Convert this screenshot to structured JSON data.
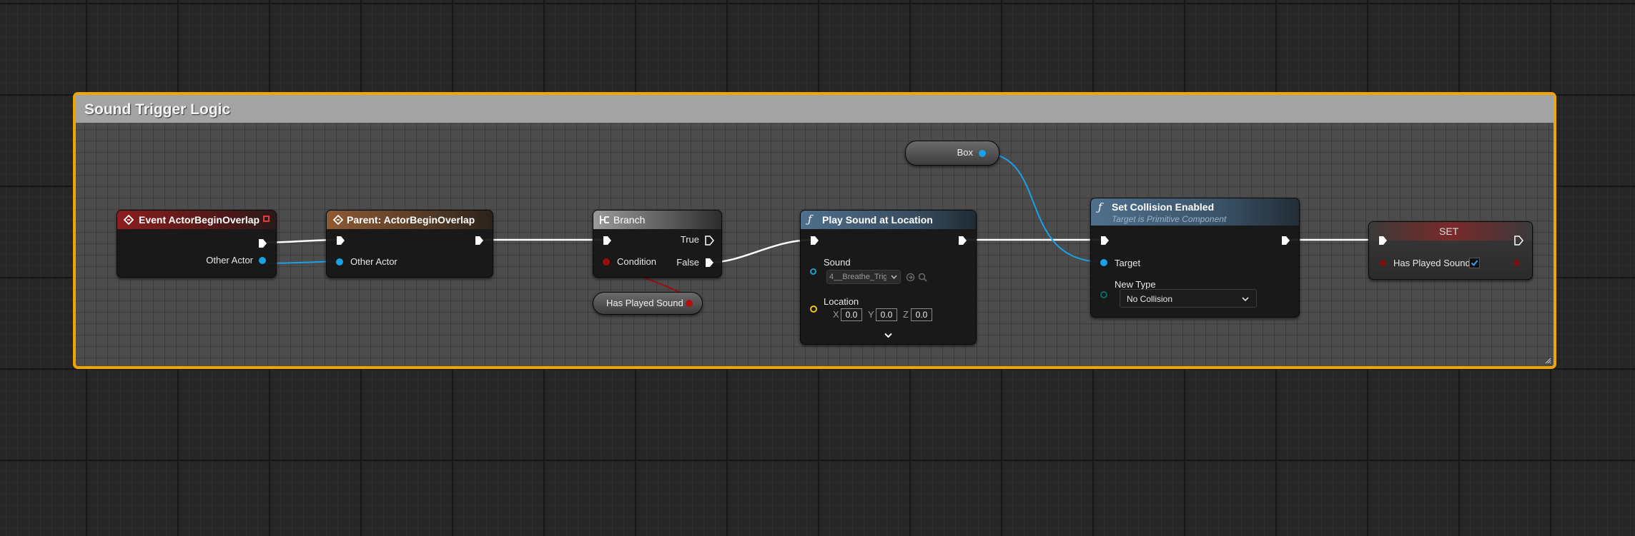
{
  "comment": {
    "title": "Sound Trigger Logic"
  },
  "colors": {
    "exec": "#ffffff",
    "object_pin": "#1aa1e6",
    "bool_pin": "#9d0e0e",
    "vector_pin": "#f0c21a",
    "sound_pin": "#1f9ec6",
    "comment_border": "#f0a400",
    "event_header": "#7c1f1f",
    "parent_header": "#8a5a36",
    "function_header": "#4d6f8e",
    "set_header": "#7a2a2a"
  },
  "nodes": {
    "event": {
      "title": "Event ActorBeginOverlap",
      "icon": "event-diamond-icon",
      "pin_other_actor": "Other Actor"
    },
    "parent": {
      "title": "Parent: ActorBeginOverlap",
      "icon": "event-diamond-icon",
      "pin_other_actor": "Other Actor"
    },
    "branch": {
      "title": "Branch",
      "icon": "branch-icon",
      "pin_condition": "Condition",
      "pin_true": "True",
      "pin_false": "False"
    },
    "has_played_getter": {
      "label": "Has Played Sound"
    },
    "box_getter": {
      "label": "Box"
    },
    "play_sound": {
      "title": "Play Sound at Location",
      "icon": "function-icon",
      "pin_sound": "Sound",
      "sound_value": "4__Breathe_Trig",
      "pin_location": "Location",
      "axis_x": "X",
      "axis_y": "Y",
      "axis_z": "Z",
      "x": "0.0",
      "y": "0.0",
      "z": "0.0"
    },
    "set_collision": {
      "title": "Set Collision Enabled",
      "subtitle": "Target is Primitive Component",
      "icon": "function-icon",
      "pin_target": "Target",
      "pin_new_type": "New Type",
      "new_type_value": "No Collision"
    },
    "set_var": {
      "title": "SET",
      "pin_label": "Has Played Sound",
      "checked": true
    }
  }
}
